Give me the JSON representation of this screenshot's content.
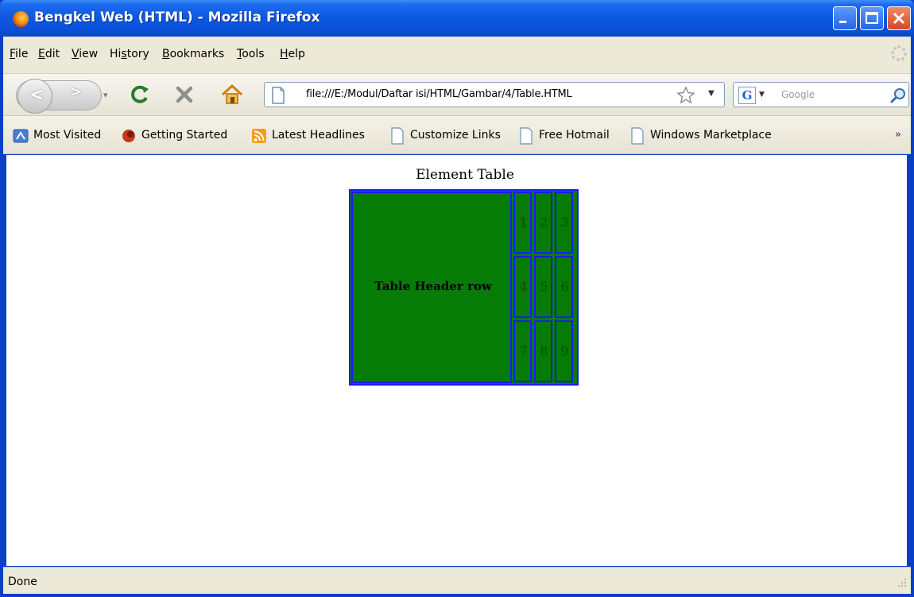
{
  "window": {
    "title": "Bengkel Web (HTML) - Mozilla Firefox"
  },
  "menu": {
    "items": [
      {
        "key": "F",
        "rest": "ile"
      },
      {
        "key": "E",
        "rest": "dit"
      },
      {
        "key": "V",
        "rest": "iew"
      },
      {
        "pre": "Hi",
        "key": "s",
        "rest": "tory"
      },
      {
        "key": "B",
        "rest": "ookmarks"
      },
      {
        "key": "T",
        "rest": "ools"
      },
      {
        "key": "H",
        "rest": "elp"
      }
    ]
  },
  "toolbar": {
    "url": "file:///E:/Modul/Daftar isi/HTML/Gambar/4/Table.HTML",
    "search_placeholder": "Google"
  },
  "bookmarks": {
    "items": [
      {
        "label": "Most Visited",
        "icon": "most-visited-icon"
      },
      {
        "label": "Getting Started",
        "icon": "firefox-icon"
      },
      {
        "label": "Latest Headlines",
        "icon": "rss-icon"
      },
      {
        "label": "Customize Links",
        "icon": "page-icon"
      },
      {
        "label": "Free Hotmail",
        "icon": "page-icon"
      },
      {
        "label": "Windows Marketplace",
        "icon": "page-icon"
      }
    ],
    "overflow": "»"
  },
  "page": {
    "caption": "Element Table",
    "header_cell": "Table Header row",
    "cells": [
      "1",
      "2",
      "3",
      "4",
      "5",
      "6",
      "7",
      "8",
      "9"
    ]
  },
  "status": {
    "text": "Done"
  },
  "colors": {
    "cell_background": "#067c06",
    "cell_border": "#1a1aff",
    "titlebar": "#0a4fd6"
  }
}
